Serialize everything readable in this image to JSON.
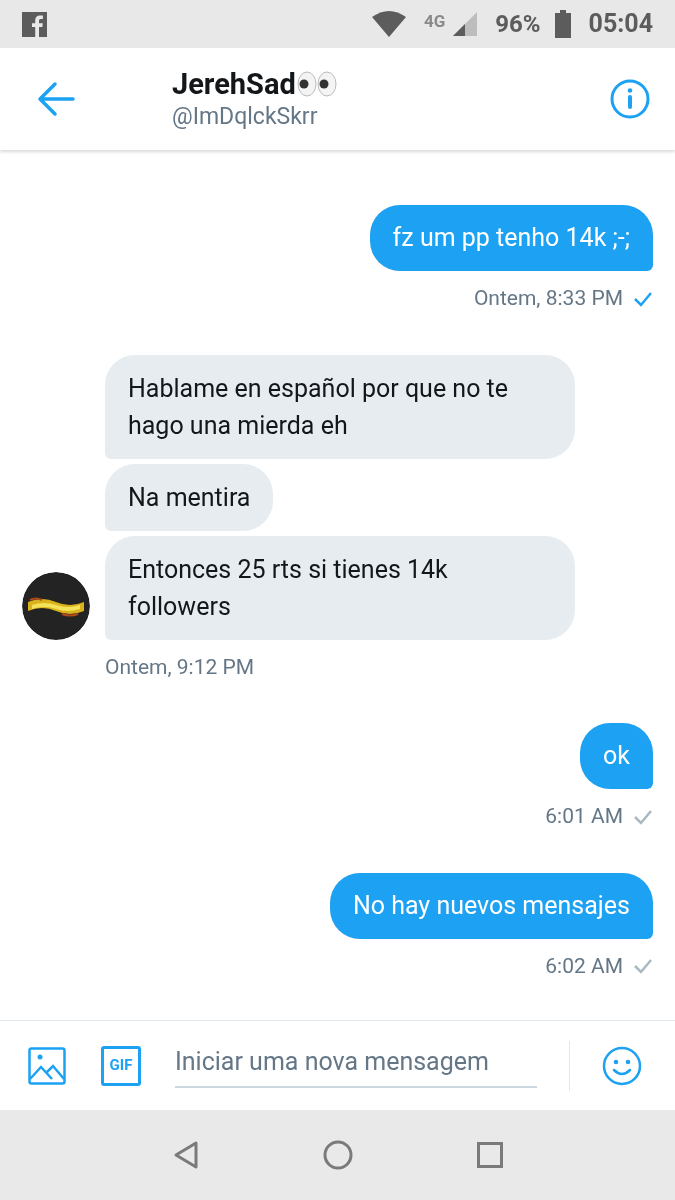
{
  "status_bar": {
    "network": "4G",
    "battery": "96%",
    "time": "05:04"
  },
  "header": {
    "name": "JerehSad",
    "handle": "@ImDqlckSkrr"
  },
  "groups": [
    {
      "kind": "sent",
      "bubbles": [
        "fz um pp tenho 14k ;-;"
      ],
      "time": "Ontem, 8:33 PM",
      "read": true
    },
    {
      "kind": "received",
      "bubbles": [
        "Hablame en español por que no te hago una mierda eh",
        "Na mentira",
        "Entonces 25 rts si tienes 14k followers"
      ],
      "time": "Ontem, 9:12 PM"
    },
    {
      "kind": "sent",
      "bubbles": [
        "ok"
      ],
      "time": "6:01 AM",
      "read": false
    },
    {
      "kind": "sent",
      "bubbles": [
        "No hay nuevos mensajes"
      ],
      "time": "6:02 AM",
      "read": false
    }
  ],
  "composer": {
    "gif_label": "GIF",
    "placeholder": "Iniciar uma nova mensagem"
  }
}
